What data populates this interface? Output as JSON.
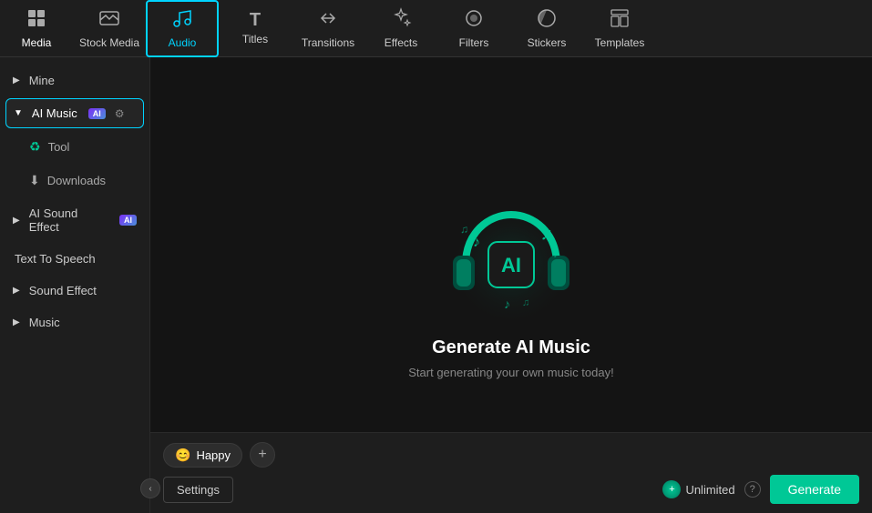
{
  "topNav": {
    "items": [
      {
        "id": "media",
        "label": "Media",
        "icon": "🖼",
        "active": false
      },
      {
        "id": "stock-media",
        "label": "Stock Media",
        "icon": "🎞",
        "active": false
      },
      {
        "id": "audio",
        "label": "Audio",
        "icon": "🎵",
        "active": true
      },
      {
        "id": "titles",
        "label": "Titles",
        "icon": "T",
        "active": false
      },
      {
        "id": "transitions",
        "label": "Transitions",
        "icon": "↔",
        "active": false
      },
      {
        "id": "effects",
        "label": "Effects",
        "icon": "✨",
        "active": false
      },
      {
        "id": "filters",
        "label": "Filters",
        "icon": "◉",
        "active": false
      },
      {
        "id": "stickers",
        "label": "Stickers",
        "icon": "📌",
        "active": false
      },
      {
        "id": "templates",
        "label": "Templates",
        "icon": "▦",
        "active": false
      }
    ]
  },
  "sidebar": {
    "items": [
      {
        "id": "mine",
        "label": "Mine",
        "type": "collapsed",
        "arrow": "▶"
      },
      {
        "id": "ai-music",
        "label": "AI Music",
        "type": "expanded",
        "arrow": "▼",
        "badge": "AI",
        "active": true
      },
      {
        "id": "tool",
        "label": "Tool",
        "type": "sub-tool"
      },
      {
        "id": "downloads",
        "label": "Downloads",
        "type": "sub"
      },
      {
        "id": "ai-sound-effect",
        "label": "AI Sound Effect",
        "type": "collapsed",
        "arrow": "▶",
        "badge": "AI"
      },
      {
        "id": "text-to-speech",
        "label": "Text To Speech",
        "type": "plain-sub"
      },
      {
        "id": "sound-effect",
        "label": "Sound Effect",
        "type": "collapsed",
        "arrow": "▶"
      },
      {
        "id": "music",
        "label": "Music",
        "type": "collapsed",
        "arrow": "▶"
      }
    ],
    "collapseArrow": "‹"
  },
  "main": {
    "title": "Generate AI Music",
    "subtitle": "Start generating your own music today!",
    "tag": "Happy",
    "tagEmoji": "😊",
    "addButtonLabel": "+",
    "settingsLabel": "Settings",
    "unlimitedLabel": "Unlimited",
    "generateLabel": "Generate",
    "helpLabel": "?"
  }
}
